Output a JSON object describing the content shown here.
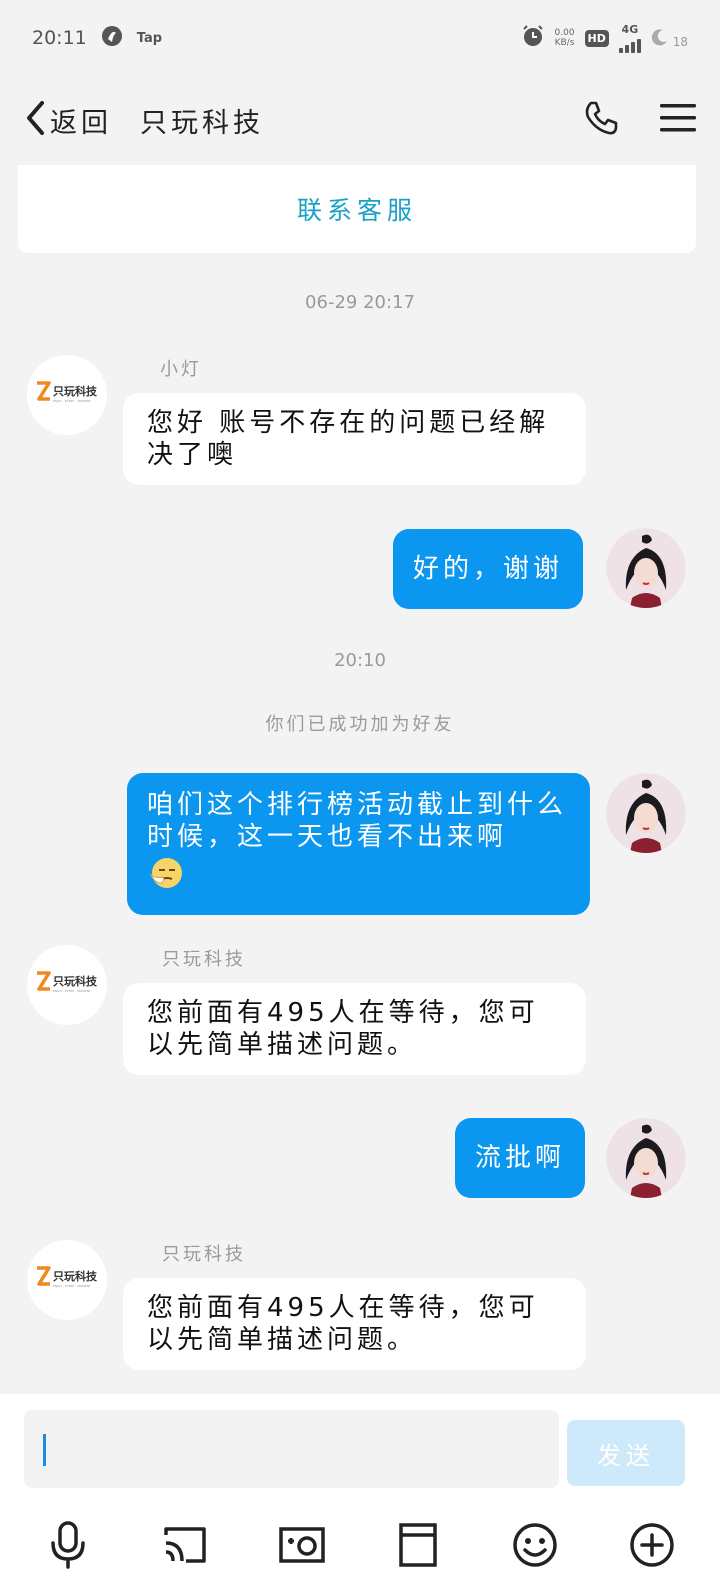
{
  "status_bar": {
    "time": "20:11",
    "app_label": "Tap",
    "net_speed_value": "0.00",
    "net_speed_unit": "KB/s",
    "hd_label": "HD",
    "network": "4G",
    "battery_level": "18"
  },
  "header": {
    "back_label": "返回",
    "title": "只玩科技"
  },
  "service_card": {
    "label": "联系客服"
  },
  "chat": {
    "timestamp_1": "06-29 20:17",
    "msg_1": {
      "sender": "小灯",
      "text": "您好 账号不存在的问题已经解决了噢"
    },
    "msg_2": {
      "text": "好的，谢谢"
    },
    "timestamp_2": "20:10",
    "system_notice": "你们已成功加为好友",
    "msg_3": {
      "text": "咱们这个排行榜活动截止到什么时候，这一天也看不出来啊"
    },
    "msg_4": {
      "sender": "只玩科技",
      "text": "您前面有495人在等待，您可以先简单描述问题。"
    },
    "msg_5": {
      "text": "流批啊"
    },
    "msg_6": {
      "sender": "只玩科技",
      "text": "您前面有495人在等待，您可以先简单描述问题。"
    }
  },
  "agent_logo": {
    "text": "只玩科技",
    "tagline": "ENJOY · EVERY · MOMENT"
  },
  "input": {
    "send_label": "发送"
  },
  "colors": {
    "accent": "#0b96ef",
    "service_link": "#1ba0c8",
    "send_disabled": "#cde9fa",
    "logo_orange": "#f08a1c"
  },
  "toolbar_icons": [
    "microphone-icon",
    "cast-icon",
    "camera-icon",
    "folder-icon",
    "emoji-icon",
    "plus-icon"
  ]
}
